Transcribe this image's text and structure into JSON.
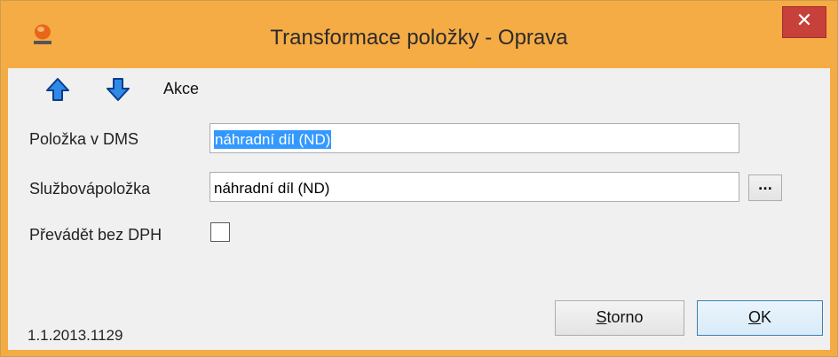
{
  "window": {
    "title": "Transformace položky - Oprava",
    "close_label": "✕",
    "accent_color": "#f6ac45",
    "close_color": "#c7403a"
  },
  "toolbar": {
    "up_icon": "arrow-up-icon",
    "down_icon": "arrow-down-icon",
    "akce_label": "Akce"
  },
  "form": {
    "dms_item_label": "Položka v DMS",
    "dms_item_value": "náhradní díl (ND)",
    "service_item_label": "Službovápoložka",
    "service_item_value": "náhradní díl (ND)",
    "browse_label": "...",
    "no_vat_label": "Převádět bez DPH",
    "no_vat_checked": false
  },
  "footer": {
    "version": "1.1.2013.1129",
    "storno_first": "S",
    "storno_rest": "torno",
    "ok_first": "O",
    "ok_rest": "K"
  }
}
